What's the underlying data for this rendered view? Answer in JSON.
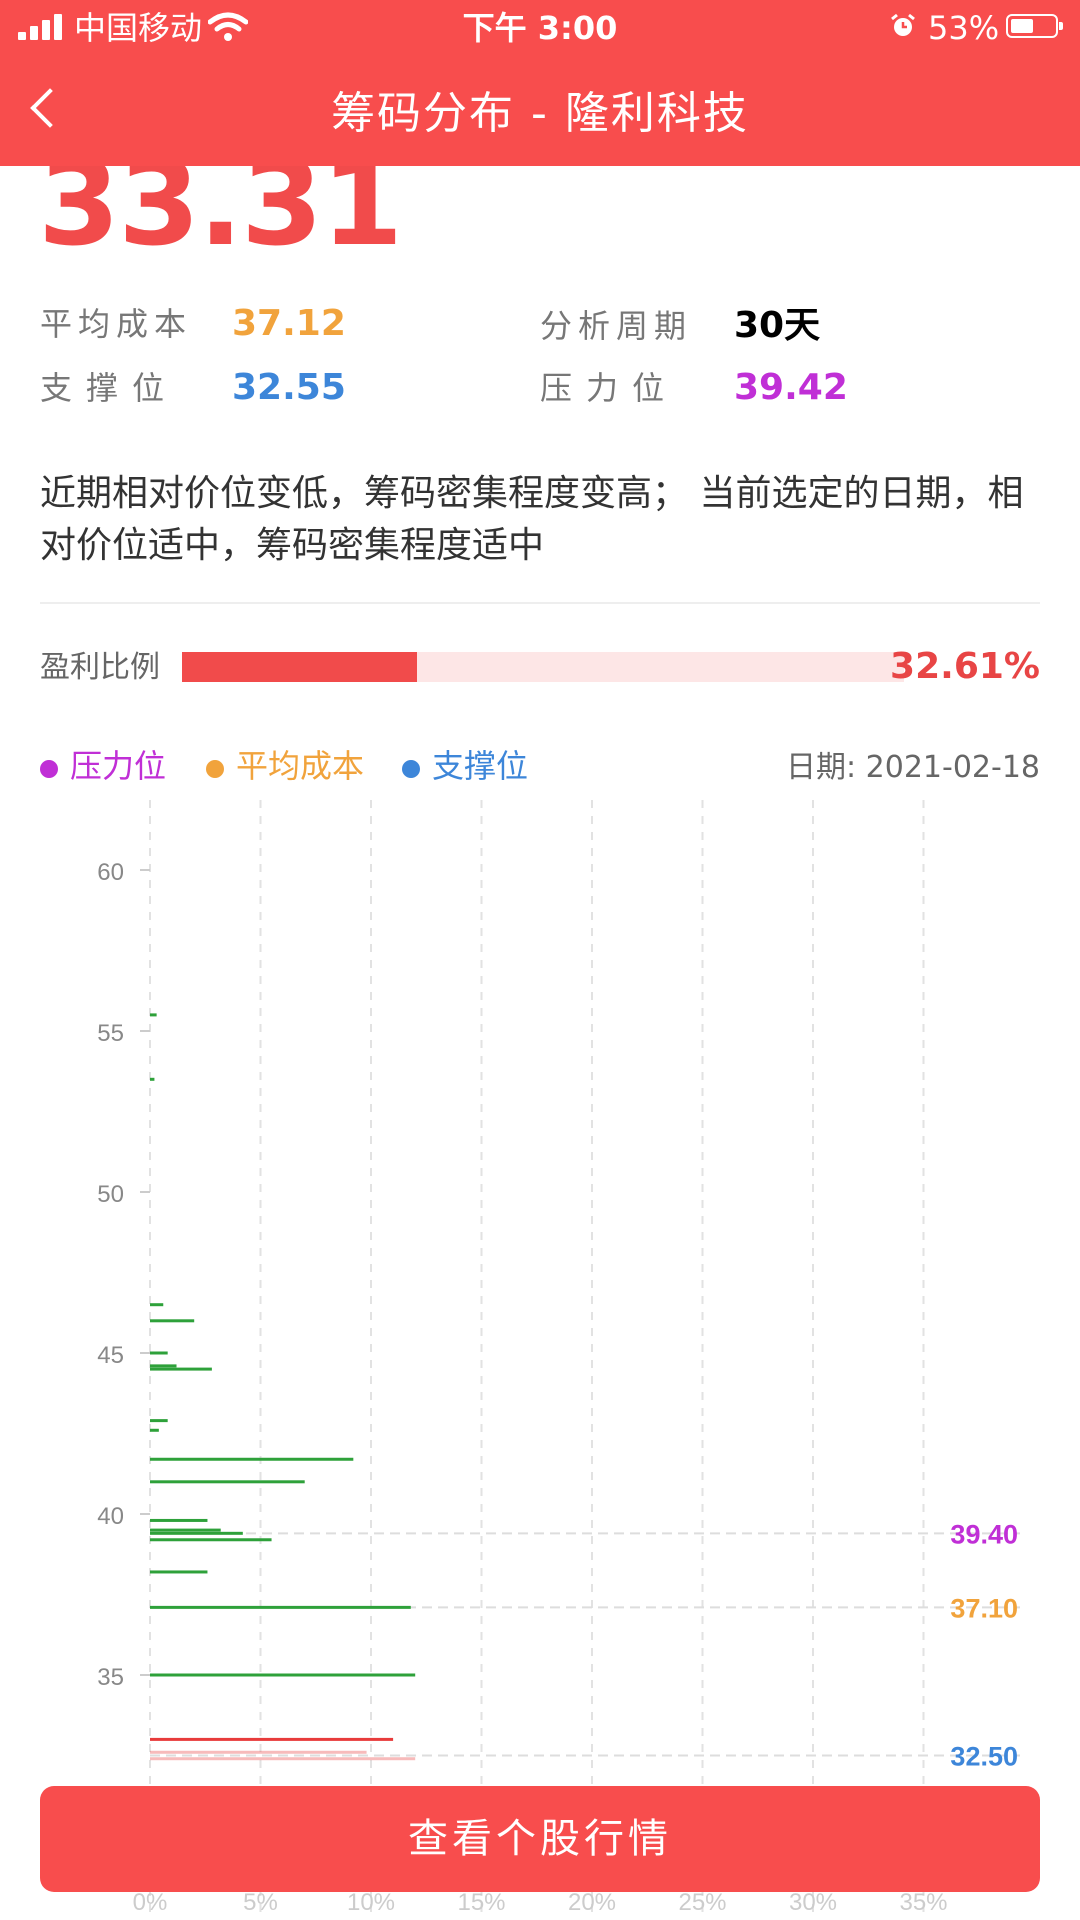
{
  "status_bar": {
    "carrier": "中国移动",
    "time": "下午 3:00",
    "battery": "53%",
    "battery_level": 0.53
  },
  "nav": {
    "title": "筹码分布 - 隆利科技"
  },
  "price": "33.31",
  "stats": {
    "avg_cost_label": "平均成本",
    "avg_cost": "37.12",
    "period_label": "分析周期",
    "period": "30天",
    "support_label": "支撑位",
    "support": "32.55",
    "pressure_label": "压力位",
    "pressure": "39.42"
  },
  "description": "近期相对价位变低，筹码密集程度变高； 当前选定的日期，相对价位适中，筹码密集程度适中",
  "profit": {
    "label": "盈利比例",
    "value": "32.61%",
    "ratio": 0.3261
  },
  "legend": {
    "pressure": "压力位",
    "avg_cost": "平均成本",
    "support": "支撑位",
    "date_label": "日期: ",
    "date": "2021-02-18"
  },
  "colors": {
    "brand": "#f84d4d",
    "pressure": "#c02fd6",
    "avg_cost": "#f1a33c",
    "support": "#3d86d9",
    "chip_green": "#2ea13a",
    "chip_red": "#e83b3b"
  },
  "chart_data": {
    "type": "bar",
    "orientation": "horizontal",
    "y_ticks": [
      35,
      40,
      45,
      50,
      55,
      60
    ],
    "x_ticks": [
      "0%",
      "5%",
      "10%",
      "15%",
      "20%",
      "25%",
      "30%",
      "35%"
    ],
    "ylim": [
      32.2,
      61
    ],
    "xlim": [
      0,
      40
    ],
    "grid": true,
    "markers": [
      {
        "name": "压力位",
        "value": 39.4,
        "label": "39.40",
        "color": "#c02fd6"
      },
      {
        "name": "平均成本",
        "value": 37.1,
        "label": "37.10",
        "color": "#f1a33c"
      },
      {
        "name": "支撑位",
        "value": 32.5,
        "label": "32.50",
        "color": "#3d86d9"
      }
    ],
    "bars": [
      {
        "price": 55.5,
        "pct": 0.3,
        "color": "green"
      },
      {
        "price": 53.5,
        "pct": 0.2,
        "color": "green"
      },
      {
        "price": 46.5,
        "pct": 0.6,
        "color": "green"
      },
      {
        "price": 46.0,
        "pct": 2.0,
        "color": "green"
      },
      {
        "price": 45.0,
        "pct": 0.8,
        "color": "green"
      },
      {
        "price": 44.6,
        "pct": 1.2,
        "color": "green"
      },
      {
        "price": 44.5,
        "pct": 2.8,
        "color": "green"
      },
      {
        "price": 42.9,
        "pct": 0.8,
        "color": "green"
      },
      {
        "price": 42.6,
        "pct": 0.4,
        "color": "green"
      },
      {
        "price": 41.7,
        "pct": 9.2,
        "color": "green"
      },
      {
        "price": 41.0,
        "pct": 7.0,
        "color": "green"
      },
      {
        "price": 39.8,
        "pct": 2.6,
        "color": "green"
      },
      {
        "price": 39.5,
        "pct": 3.2,
        "color": "green"
      },
      {
        "price": 39.4,
        "pct": 4.2,
        "color": "green"
      },
      {
        "price": 39.2,
        "pct": 5.5,
        "color": "green"
      },
      {
        "price": 38.2,
        "pct": 2.6,
        "color": "green"
      },
      {
        "price": 37.1,
        "pct": 11.8,
        "color": "green"
      },
      {
        "price": 35.0,
        "pct": 12.0,
        "color": "green"
      },
      {
        "price": 33.0,
        "pct": 11.0,
        "color": "red"
      },
      {
        "price": 32.6,
        "pct": 9.8,
        "color": "red"
      },
      {
        "price": 32.4,
        "pct": 12.0,
        "color": "red"
      }
    ]
  },
  "cta": {
    "label": "查看个股行情"
  }
}
